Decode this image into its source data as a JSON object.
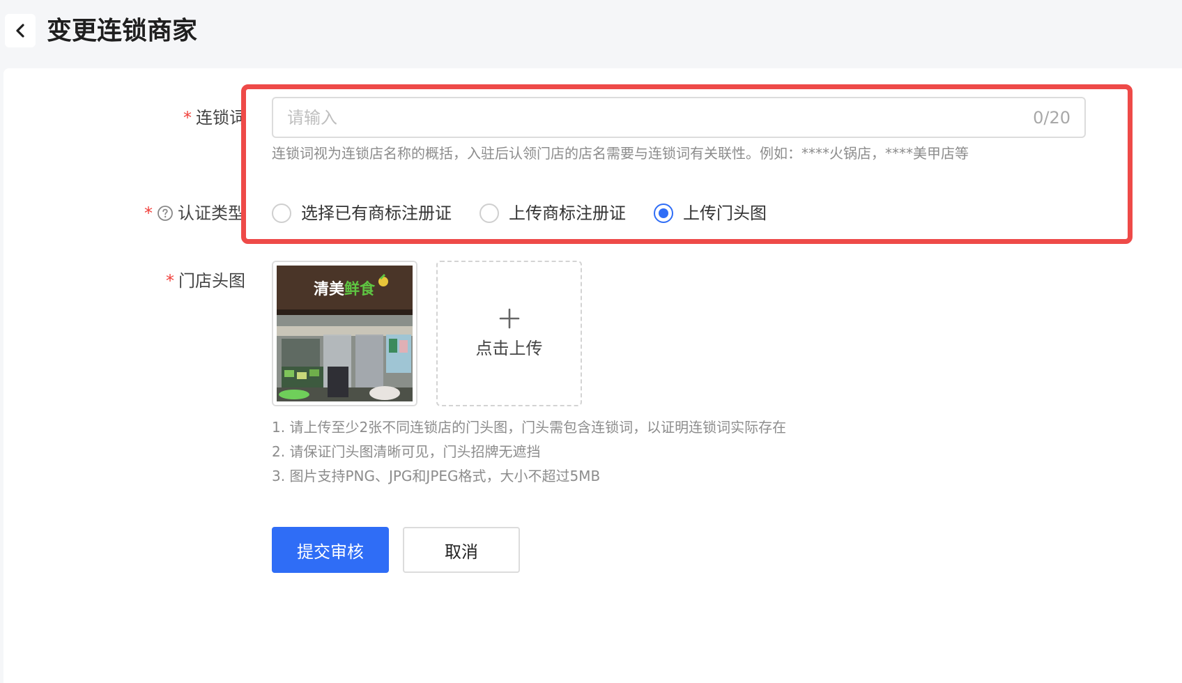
{
  "header": {
    "title": "变更连锁商家",
    "back_icon": "chevron-left-icon"
  },
  "form": {
    "chain_word": {
      "required_mark": "*",
      "label": "连锁词",
      "placeholder": "请输入",
      "value": "",
      "counter": "0/20",
      "hint": "连锁词视为连锁店名称的概括，入驻后认领门店的店名需要与连锁词有关联性。例如：****火锅店，****美甲店等"
    },
    "cert_type": {
      "required_mark": "*",
      "help_icon": "question-circle-icon",
      "label": "认证类型",
      "options": [
        {
          "label": "选择已有商标注册证",
          "checked": false
        },
        {
          "label": "上传商标注册证",
          "checked": false
        },
        {
          "label": "上传门头图",
          "checked": true
        }
      ]
    },
    "storefront_image": {
      "required_mark": "*",
      "label": "门店头图",
      "uploaded_sign_text": "清美鲜食",
      "upload_label": "点击上传",
      "upload_icon": "plus-icon",
      "tips": [
        "1. 请上传至少2张不同连锁店的门头图，门头需包含连锁词，以证明连锁词实际存在",
        "2. 请保证门头图清晰可见，门头招牌无遮挡",
        "3. 图片支持PNG、JPG和JPEG格式，大小不超过5MB"
      ]
    }
  },
  "actions": {
    "submit_label": "提交审核",
    "cancel_label": "取消"
  },
  "colors": {
    "primary": "#2f6df6",
    "required": "#f0413c",
    "highlight": "#ee4a48"
  }
}
